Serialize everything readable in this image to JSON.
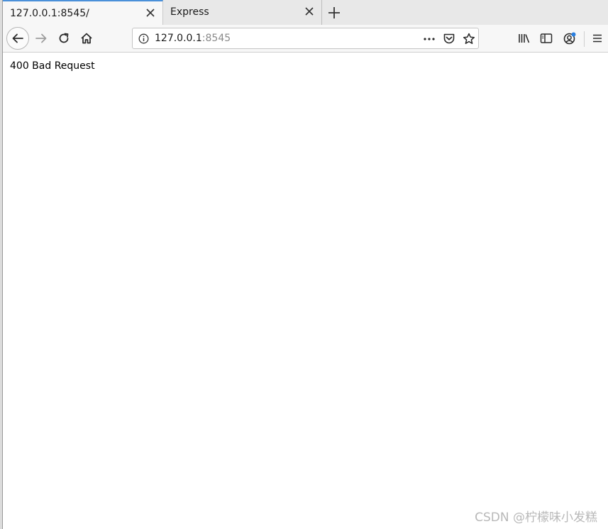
{
  "browser": {
    "tabs": [
      {
        "title": "127.0.0.1:8545/",
        "active": true
      },
      {
        "title": "Express",
        "active": false
      }
    ],
    "url": {
      "host": "127.0.0.1",
      "port": ":8545"
    },
    "accent_color": "#4a90d9"
  },
  "icons": {
    "tab_close": "close-icon",
    "new_tab": "plus-icon",
    "back": "arrow-left-icon",
    "forward": "arrow-right-icon",
    "reload": "reload-icon",
    "home": "home-icon",
    "site_info": "info-icon",
    "page_actions": "more-horizontal-icon",
    "pocket": "pocket-icon",
    "bookmark": "star-icon",
    "library": "library-icon",
    "sidebar": "sidebar-icon",
    "account": "account-icon",
    "menu": "hamburger-menu-icon"
  },
  "page": {
    "body_text": "400 Bad Request"
  },
  "watermark": "CSDN @柠檬味小发糕"
}
